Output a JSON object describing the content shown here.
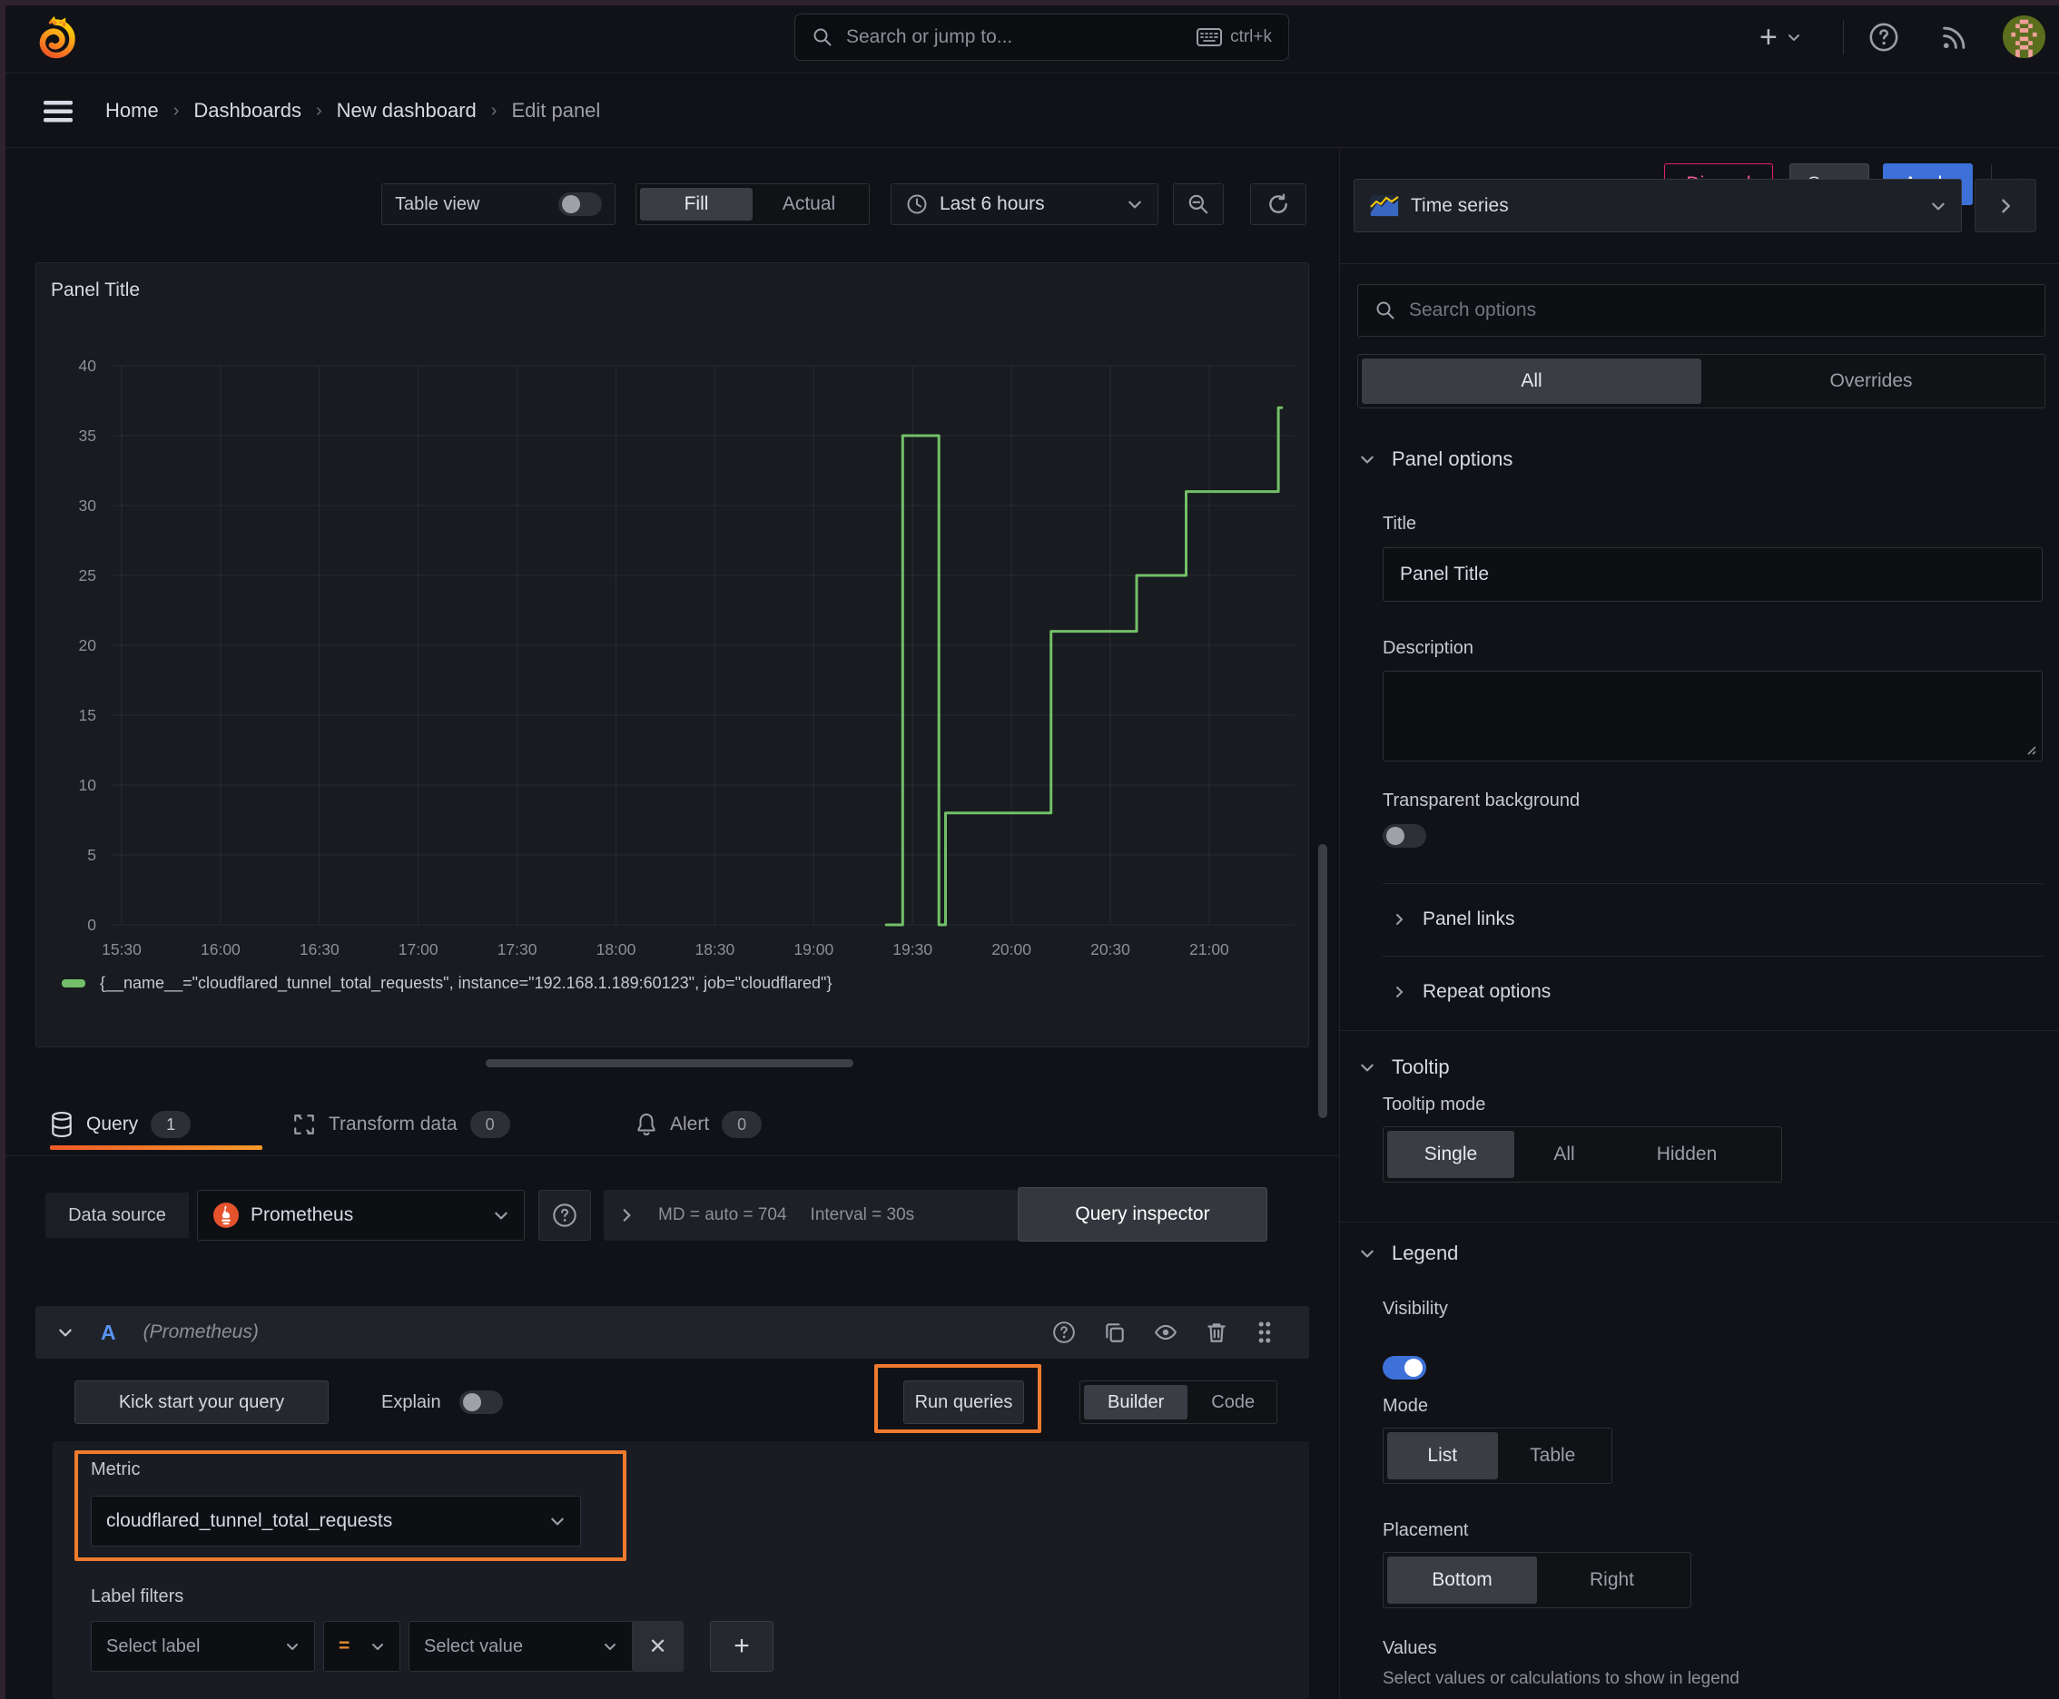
{
  "topnav": {
    "search_placeholder": "Search or jump to...",
    "search_shortcut": "ctrl+k"
  },
  "breadcrumb": {
    "items": [
      "Home",
      "Dashboards",
      "New dashboard"
    ],
    "current": "Edit panel"
  },
  "actions": {
    "discard": "Discard",
    "save": "Save",
    "apply": "Apply"
  },
  "toolbar": {
    "table_view": "Table view",
    "fill": "Fill",
    "actual": "Actual",
    "time_range": "Last 6 hours"
  },
  "panel": {
    "title": "Panel Title"
  },
  "chart_data": {
    "type": "line",
    "interpolation": "step-after",
    "title": "Panel Title",
    "x_ticks": [
      "15:30",
      "16:00",
      "16:30",
      "17:00",
      "17:30",
      "18:00",
      "18:30",
      "19:00",
      "19:30",
      "20:00",
      "20:30",
      "21:00"
    ],
    "y_ticks": [
      0,
      5,
      10,
      15,
      20,
      25,
      30,
      35,
      40
    ],
    "ylim": [
      0,
      40
    ],
    "x_range": [
      "15:22",
      "21:26"
    ],
    "grid": true,
    "legend_position": "bottom",
    "series": [
      {
        "name": "{__name__=\"cloudflared_tunnel_total_requests\", instance=\"192.168.1.189:60123\", job=\"cloudflared\"}",
        "color": "#73bf69",
        "points": [
          [
            "19:22",
            0
          ],
          [
            "19:27",
            0
          ],
          [
            "19:27",
            35
          ],
          [
            "19:38",
            35
          ],
          [
            "19:38",
            0
          ],
          [
            "19:40",
            0
          ],
          [
            "19:40",
            8
          ],
          [
            "20:12",
            8
          ],
          [
            "20:12",
            21
          ],
          [
            "20:38",
            21
          ],
          [
            "20:38",
            25
          ],
          [
            "20:53",
            25
          ],
          [
            "20:53",
            31
          ],
          [
            "21:21",
            31
          ],
          [
            "21:21",
            37
          ],
          [
            "21:22",
            37
          ]
        ]
      }
    ]
  },
  "query_section": {
    "tabs": [
      {
        "label": "Query",
        "count": "1"
      },
      {
        "label": "Transform data",
        "count": "0"
      },
      {
        "label": "Alert",
        "count": "0"
      }
    ],
    "datasource_label": "Data source",
    "datasource": "Prometheus",
    "max_data_points": "MD = auto = 704",
    "interval": "Interval = 30s",
    "query_inspector": "Query inspector",
    "query_ref": "A",
    "query_ds_hint": "(Prometheus)",
    "kick_start": "Kick start your query",
    "explain": "Explain",
    "run_queries": "Run queries",
    "builder": "Builder",
    "code": "Code",
    "metric_label": "Metric",
    "metric_value": "cloudflared_tunnel_total_requests",
    "label_filters_label": "Label filters",
    "select_label_placeholder": "Select label",
    "operator": "=",
    "select_value_placeholder": "Select value"
  },
  "options_pane": {
    "viz_type": "Time series",
    "search_placeholder": "Search options",
    "tab_all": "All",
    "tab_overrides": "Overrides",
    "panel_options": {
      "header": "Panel options",
      "title_label": "Title",
      "title_value": "Panel Title",
      "description_label": "Description",
      "description_value": "",
      "transparent_label": "Transparent background"
    },
    "panel_links": "Panel links",
    "repeat_options": "Repeat options",
    "tooltip": {
      "header": "Tooltip",
      "mode_label": "Tooltip mode",
      "modes": [
        "Single",
        "All",
        "Hidden"
      ],
      "selected": "Single"
    },
    "legend": {
      "header": "Legend",
      "visibility_label": "Visibility",
      "mode_label": "Mode",
      "modes": [
        "List",
        "Table"
      ],
      "selected_mode": "List",
      "placement_label": "Placement",
      "placements": [
        "Bottom",
        "Right"
      ],
      "selected_placement": "Bottom",
      "values_label": "Values",
      "values_hint": "Select values or calculations to show in legend"
    }
  },
  "colors": {
    "series_green": "#73bf69",
    "accent_orange": "#ff780a",
    "highlight_orange": "#ee7a2e",
    "primary_blue": "#3d71d9",
    "destructive_pink": "#e0226c"
  }
}
